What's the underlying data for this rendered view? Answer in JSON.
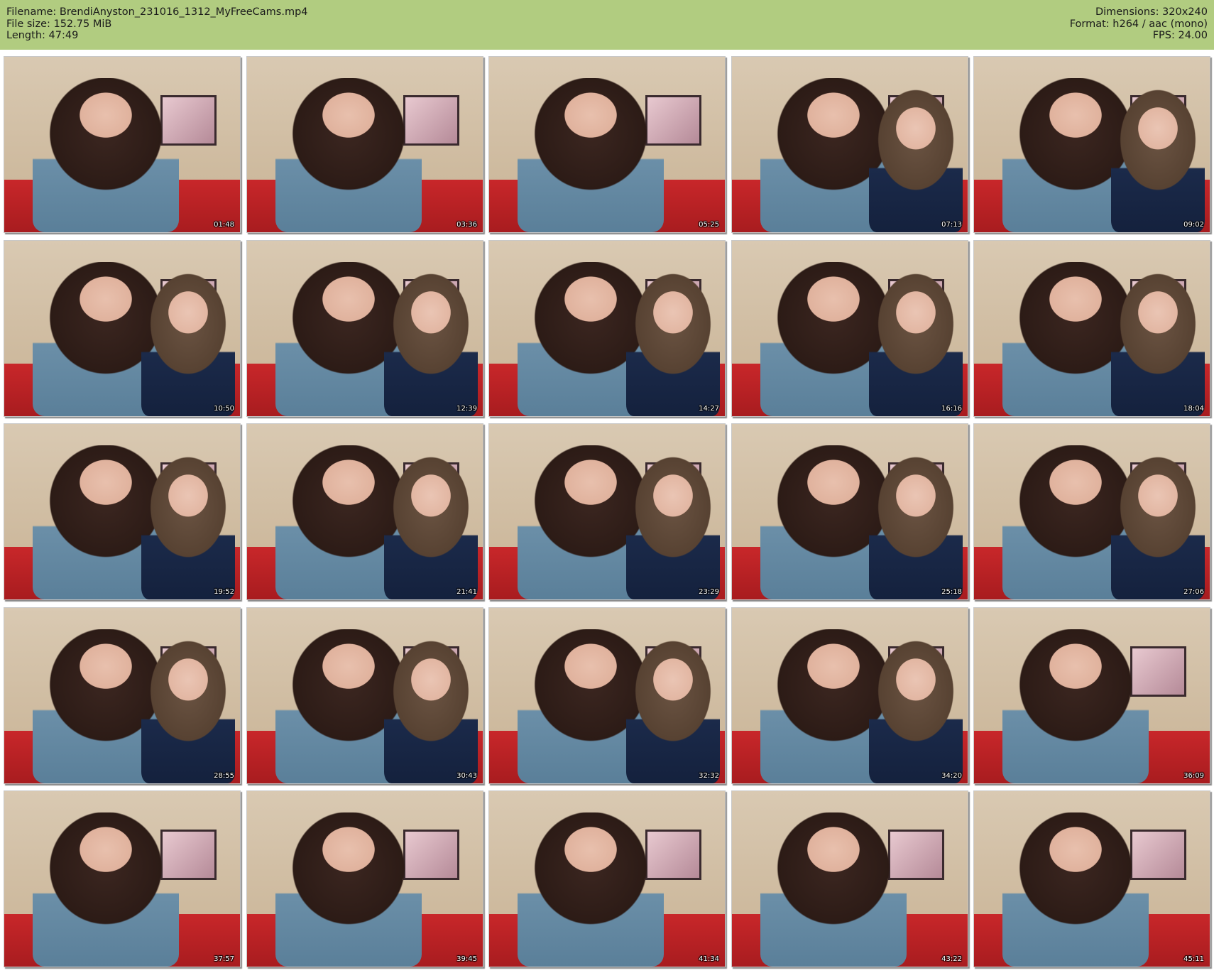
{
  "header": {
    "filename": "Filename: BrendiAnyston_231016_1312_MyFreeCams.mp4",
    "filesize": "File size: 152.75 MiB",
    "length": "Length: 47:49",
    "dimensions": "Dimensions: 320x240",
    "format": "Format: h264 / aac (mono)",
    "fps": "FPS: 24.00"
  },
  "colors": {
    "header_bg": "#b1cc80"
  },
  "thumbnails": [
    {
      "time": "01:48",
      "second_person": false
    },
    {
      "time": "03:36",
      "second_person": false
    },
    {
      "time": "05:25",
      "second_person": false
    },
    {
      "time": "07:13",
      "second_person": true
    },
    {
      "time": "09:02",
      "second_person": true
    },
    {
      "time": "10:50",
      "second_person": true
    },
    {
      "time": "12:39",
      "second_person": true
    },
    {
      "time": "14:27",
      "second_person": true
    },
    {
      "time": "16:16",
      "second_person": true
    },
    {
      "time": "18:04",
      "second_person": true
    },
    {
      "time": "19:52",
      "second_person": true
    },
    {
      "time": "21:41",
      "second_person": true
    },
    {
      "time": "23:29",
      "second_person": true
    },
    {
      "time": "25:18",
      "second_person": true
    },
    {
      "time": "27:06",
      "second_person": true
    },
    {
      "time": "28:55",
      "second_person": true
    },
    {
      "time": "30:43",
      "second_person": true
    },
    {
      "time": "32:32",
      "second_person": true
    },
    {
      "time": "34:20",
      "second_person": true
    },
    {
      "time": "36:09",
      "second_person": false
    },
    {
      "time": "37:57",
      "second_person": false
    },
    {
      "time": "39:45",
      "second_person": false
    },
    {
      "time": "41:34",
      "second_person": false
    },
    {
      "time": "43:22",
      "second_person": false
    },
    {
      "time": "45:11",
      "second_person": false
    }
  ]
}
